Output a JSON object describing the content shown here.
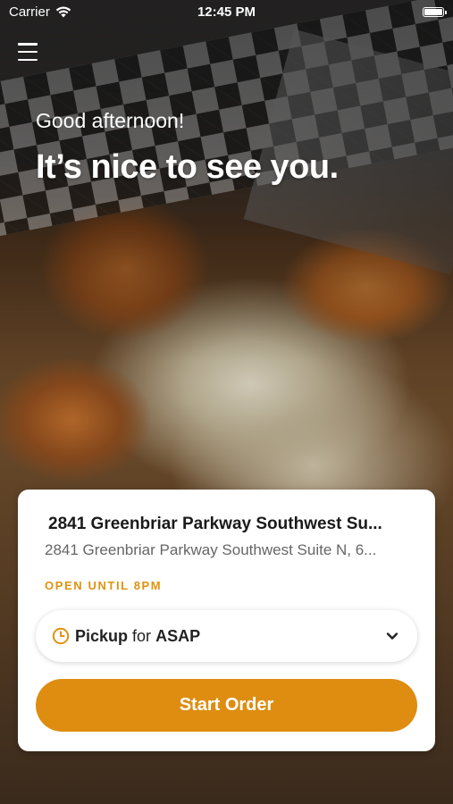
{
  "status_bar": {
    "carrier": "Carrier",
    "time": "12:45 PM"
  },
  "header": {
    "greeting": "Good afternoon!",
    "headline": "It’s nice to see you."
  },
  "location_card": {
    "name": "2841 Greenbriar Parkway Southwest Su...",
    "address": "2841 Greenbriar Parkway Southwest Suite N, 6...",
    "hours_status": "OPEN UNTIL 8PM",
    "order_mode": {
      "mode": "Pickup",
      "connector": "for",
      "time": "ASAP"
    },
    "start_order_label": "Start Order"
  },
  "colors": {
    "accent": "#de8d10",
    "hours_text": "#e0920e"
  },
  "icons": [
    "wifi-icon",
    "battery-icon",
    "hamburger-menu-icon",
    "clock-icon",
    "chevron-down-icon"
  ]
}
